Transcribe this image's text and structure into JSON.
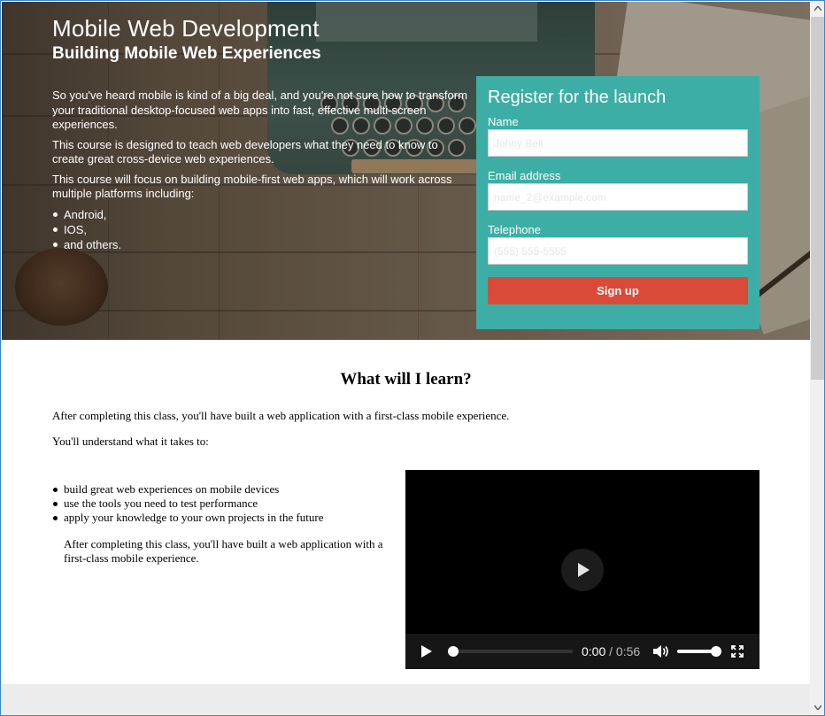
{
  "hero": {
    "title": "Mobile Web Development",
    "subtitle": "Building Mobile Web Experiences",
    "paragraphs": [
      "So you've heard mobile is kind of a big deal, and you're not sure how to transform your traditional desktop-focused web apps into fast, effective multi-screen experiences.",
      "This course is designed to teach web developers what they need to know to create great cross-device web experiences.",
      "This course will focus on building mobile-first web apps, which will work across multiple platforms including:"
    ],
    "platforms": [
      "Android,",
      "IOS,",
      "and others."
    ]
  },
  "register": {
    "heading": "Register for the launch",
    "name_label": "Name",
    "name_placeholder": "Johny Bell",
    "email_label": "Email address",
    "email_placeholder": "name_2@example.com",
    "phone_label": "Telephone",
    "phone_placeholder": "(555) 555-5555",
    "signup_label": "Sign up",
    "accent_color": "#3daea5",
    "button_color": "#d94b38"
  },
  "learn": {
    "heading": "What will I learn?",
    "intro": "After completing this class, you'll have built a web application with a first-class mobile experience.",
    "lead": "You'll understand what it takes to:",
    "items": [
      "build great web experiences on mobile devices",
      "use the tools you need to test performance",
      "apply your knowledge to your own projects in the future"
    ],
    "note": "After completing this class, you'll have built a web application with a first-class mobile experience."
  },
  "video": {
    "current_time": "0:00",
    "separator": " / ",
    "duration": "0:56",
    "progress": 0,
    "volume": 1.0,
    "icons": [
      "play-icon",
      "volume-icon",
      "fullscreen-icon"
    ]
  }
}
